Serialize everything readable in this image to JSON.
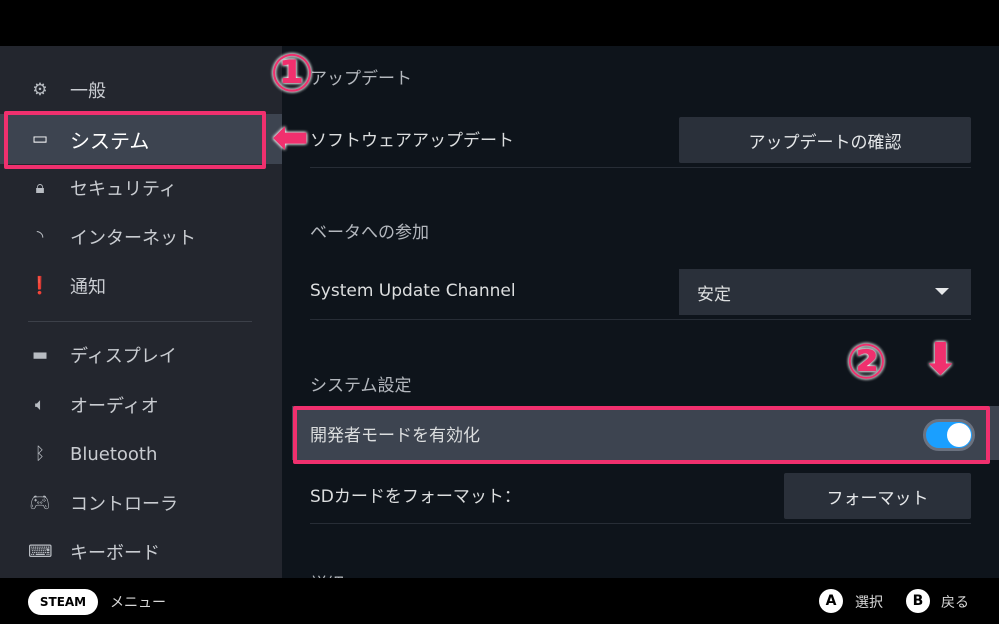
{
  "sidebar": {
    "items": [
      {
        "label": "一般",
        "icon": "gear-icon"
      },
      {
        "label": "システム",
        "icon": "handheld-icon",
        "selected": true
      },
      {
        "label": "セキュリティ",
        "icon": "lock-icon"
      },
      {
        "label": "インターネット",
        "icon": "wifi-icon"
      },
      {
        "label": "通知",
        "icon": "alert-icon"
      },
      {
        "label": "ディスプレイ",
        "icon": "monitor-icon"
      },
      {
        "label": "オーディオ",
        "icon": "speaker-icon"
      },
      {
        "label": "Bluetooth",
        "icon": "bluetooth-icon"
      },
      {
        "label": "コントローラ",
        "icon": "gamepad-icon"
      },
      {
        "label": "キーボード",
        "icon": "keyboard-icon"
      }
    ]
  },
  "main": {
    "update": {
      "heading": "アップデート",
      "software_label": "ソフトウェアアップデート",
      "check_button": "アップデートの確認"
    },
    "beta": {
      "heading": "ベータへの参加",
      "channel_label": "System Update Channel",
      "channel_value": "安定"
    },
    "system": {
      "heading": "システム設定",
      "dev_mode_label": "開発者モードを有効化",
      "dev_mode_on": true,
      "sd_label": "SDカードをフォーマット：",
      "format_button": "フォーマット"
    },
    "next_heading": "詳細"
  },
  "footer": {
    "steam": "STEAM",
    "menu": "メニュー",
    "a": "A",
    "a_label": "選択",
    "b": "B",
    "b_label": "戻る"
  },
  "annotations": {
    "one": "①",
    "two": "②"
  },
  "colors": {
    "accent": "#1a9fff",
    "highlight": "#f0306e"
  }
}
